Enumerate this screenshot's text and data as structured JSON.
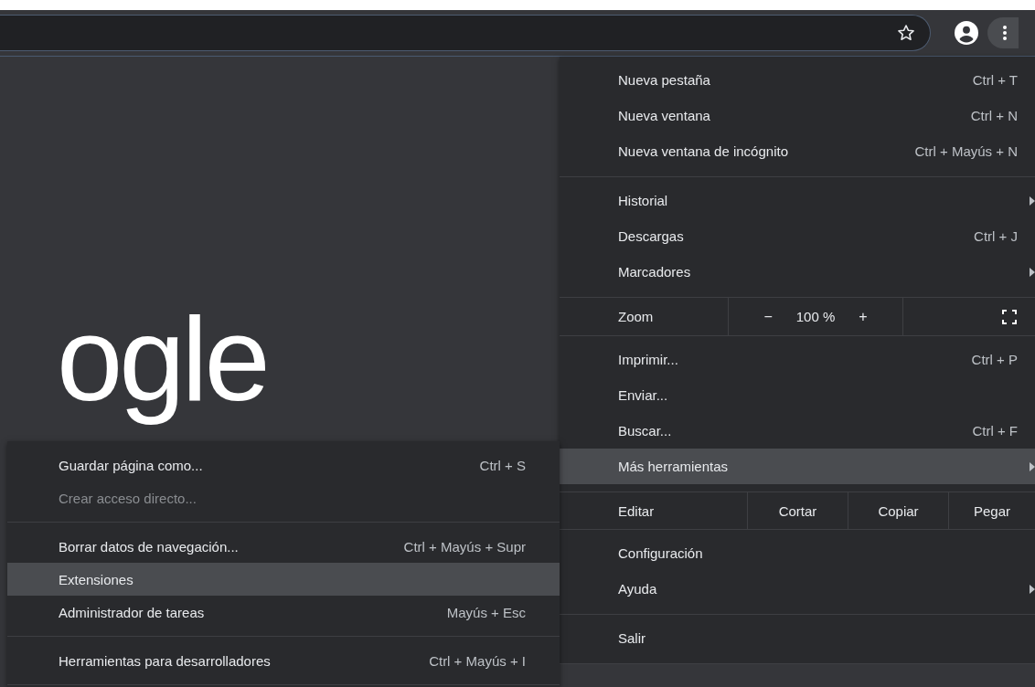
{
  "toolbar": {
    "menu_button_selected": true
  },
  "page": {
    "logo_text": "ogle"
  },
  "menu": {
    "sections": [
      [
        {
          "kind": "item",
          "label": "Nueva pestaña",
          "shortcut": "Ctrl + T",
          "submenu": false,
          "selected": false
        },
        {
          "kind": "item",
          "label": "Nueva ventana",
          "shortcut": "Ctrl + N",
          "submenu": false,
          "selected": false
        },
        {
          "kind": "item",
          "label": "Nueva ventana de incógnito",
          "shortcut": "Ctrl + Mayús + N",
          "submenu": false,
          "selected": false
        }
      ],
      [
        {
          "kind": "item",
          "label": "Historial",
          "submenu": true,
          "selected": false
        },
        {
          "kind": "item",
          "label": "Descargas",
          "shortcut": "Ctrl + J",
          "submenu": false,
          "selected": false
        },
        {
          "kind": "item",
          "label": "Marcadores",
          "submenu": true,
          "selected": false
        }
      ],
      [
        {
          "kind": "zoom",
          "label": "Zoom",
          "minus": "−",
          "value": "100 %",
          "plus": "+"
        }
      ],
      [
        {
          "kind": "item",
          "label": "Imprimir...",
          "shortcut": "Ctrl + P",
          "submenu": false,
          "selected": false
        },
        {
          "kind": "item",
          "label": "Enviar...",
          "submenu": false,
          "selected": false
        },
        {
          "kind": "item",
          "label": "Buscar...",
          "shortcut": "Ctrl + F",
          "submenu": false,
          "selected": false
        },
        {
          "kind": "item",
          "label": "Más herramientas",
          "submenu": true,
          "selected": true
        }
      ],
      [
        {
          "kind": "edit",
          "label": "Editar",
          "buttons": [
            "Cortar",
            "Copiar",
            "Pegar"
          ]
        }
      ],
      [
        {
          "kind": "item",
          "label": "Configuración",
          "submenu": false,
          "selected": false
        },
        {
          "kind": "item",
          "label": "Ayuda",
          "submenu": true,
          "selected": false
        }
      ],
      [
        {
          "kind": "item",
          "label": "Salir",
          "submenu": false,
          "selected": false
        }
      ]
    ]
  },
  "submenu": {
    "sections": [
      [
        {
          "kind": "item",
          "label": "Guardar página como...",
          "shortcut": "Ctrl + S",
          "selected": false,
          "disabled": false
        },
        {
          "kind": "item",
          "label": "Crear acceso directo...",
          "selected": false,
          "disabled": true
        }
      ],
      [
        {
          "kind": "item",
          "label": "Borrar datos de navegación...",
          "shortcut": "Ctrl + Mayús + Supr",
          "selected": false,
          "disabled": false
        },
        {
          "kind": "item",
          "label": "Extensiones",
          "selected": true,
          "disabled": false
        },
        {
          "kind": "item",
          "label": "Administrador de tareas",
          "shortcut": "Mayús + Esc",
          "selected": false,
          "disabled": false
        }
      ],
      [
        {
          "kind": "item",
          "label": "Herramientas para desarrolladores",
          "shortcut": "Ctrl + Mayús + I",
          "selected": false,
          "disabled": false
        }
      ]
    ]
  }
}
